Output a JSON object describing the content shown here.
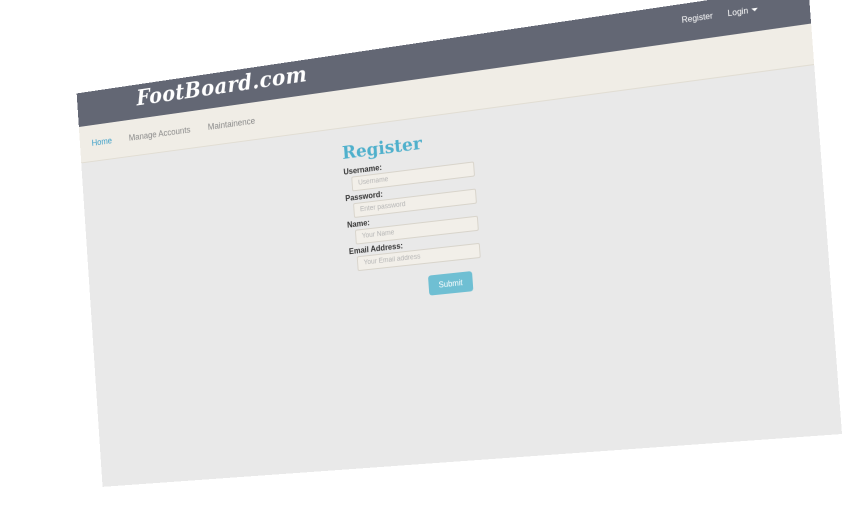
{
  "header": {
    "brand": "FootBoard.com",
    "register_link": "Register",
    "login_link": "Login"
  },
  "nav": {
    "items": [
      {
        "label": "Home",
        "active": true
      },
      {
        "label": "Manage Accounts",
        "active": false
      },
      {
        "label": "Maintainence",
        "active": false
      }
    ]
  },
  "form": {
    "title": "Register",
    "fields": [
      {
        "label": "Username:",
        "placeholder": "Username"
      },
      {
        "label": "Password:",
        "placeholder": "Enter password"
      },
      {
        "label": "Name:",
        "placeholder": "Your Name"
      },
      {
        "label": "Email Address:",
        "placeholder": "Your Email address"
      }
    ],
    "submit_label": "Submit"
  },
  "colors": {
    "topbar": "#636774",
    "navbar": "#f0ede6",
    "accent": "#4fb0cc",
    "button": "#6fbfd3",
    "page_bg": "#e9e9e9"
  }
}
